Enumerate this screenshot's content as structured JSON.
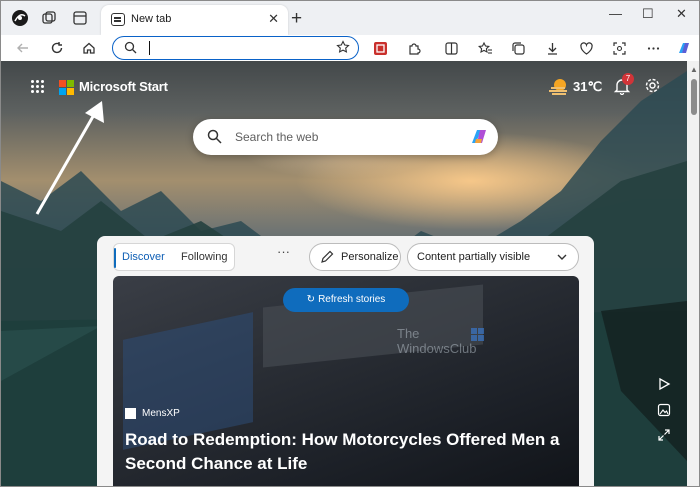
{
  "browser": {
    "tab_title": "New tab",
    "tab_close": "✕",
    "new_tab": "+",
    "window_controls": [
      "—",
      "☐",
      "✕"
    ],
    "toolbar_icons": [
      "back-icon",
      "refresh-icon",
      "home-icon",
      "star-icon",
      "ad-block-icon",
      "extensions-icon",
      "split-screen-icon",
      "favorites-icon",
      "collections-icon",
      "downloads-icon",
      "browser-essentials-icon",
      "screenshot-icon",
      "more-icon",
      "copilot-icon"
    ]
  },
  "page": {
    "brand": "Microsoft Start",
    "weather": {
      "temp": "31℃"
    },
    "notifications": {
      "count": "7"
    },
    "search": {
      "placeholder": "Search the web"
    }
  },
  "feed": {
    "tabs": [
      "Discover",
      "Following"
    ],
    "more": "···",
    "personalize": "Personalize",
    "content_visibility": "Content partially visible",
    "refresh": "Refresh stories",
    "watermark": [
      "The",
      "WindowsClub"
    ],
    "story": {
      "source": "MensXP",
      "headline": "Road to Redemption: How Motorcycles Offered Men a Second Chance at Life"
    }
  },
  "colors": {
    "accent": "#0f6cbd",
    "badge": "#d13438",
    "ms_red": "#f25022",
    "ms_green": "#7fba00",
    "ms_blue": "#00a4ef",
    "ms_yellow": "#ffb900"
  }
}
